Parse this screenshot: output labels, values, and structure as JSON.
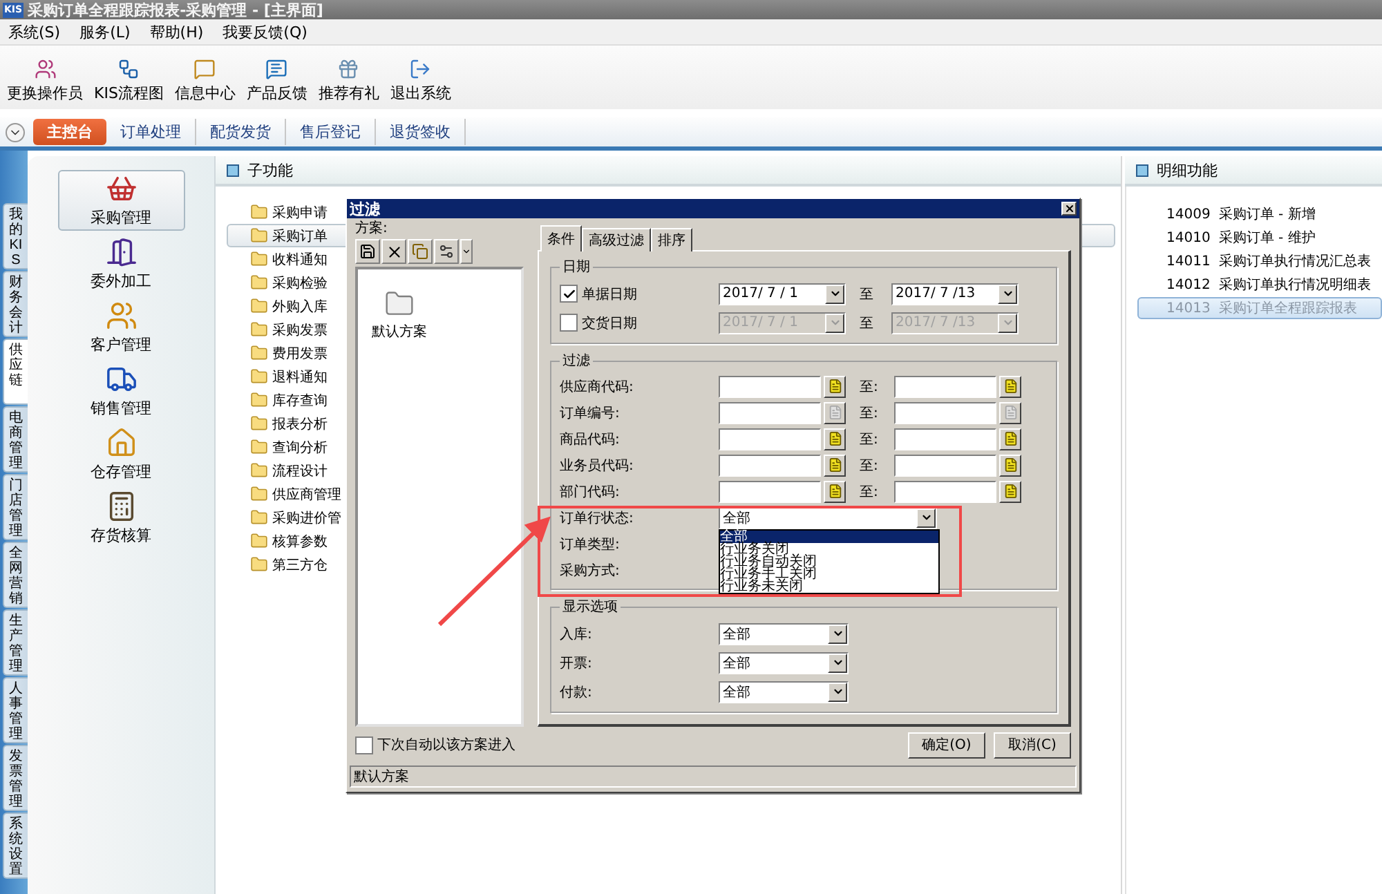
{
  "window": {
    "logo": "KIS",
    "title": "采购订单全程跟踪报表-采购管理 - [主界面]"
  },
  "menu": [
    "系统(S)",
    "服务(L)",
    "帮助(H)",
    "我要反馈(Q)"
  ],
  "toolbar": [
    {
      "kind": "operator",
      "label": "更换操作员"
    },
    {
      "kind": "flow",
      "label": "KIS流程图"
    },
    {
      "kind": "message",
      "label": "信息中心"
    },
    {
      "kind": "feedback",
      "label": "产品反馈"
    },
    {
      "kind": "gift",
      "label": "推荐有礼"
    },
    {
      "kind": "exit",
      "label": "退出系统"
    }
  ],
  "nav_tabs": [
    {
      "label": "主控台",
      "selected": true
    },
    {
      "label": "订单处理",
      "selected": false
    },
    {
      "label": "配货发货",
      "selected": false
    },
    {
      "label": "售后登记",
      "selected": false
    },
    {
      "label": "退货签收",
      "selected": false
    }
  ],
  "side_tabs": [
    {
      "label": "我的KIS",
      "selected": false
    },
    {
      "label": "财务会计",
      "selected": false
    },
    {
      "label": "供应链",
      "selected": true
    },
    {
      "label": "电商管理",
      "selected": false
    },
    {
      "label": "门店管理",
      "selected": false
    },
    {
      "label": "全网营销",
      "selected": false
    },
    {
      "label": "生产管理",
      "selected": false
    },
    {
      "label": "人事管理",
      "selected": false
    },
    {
      "label": "发票管理",
      "selected": false
    },
    {
      "label": "系统设置",
      "selected": false
    }
  ],
  "modules": [
    {
      "kind": "purchase",
      "label": "采购管理",
      "selected": true
    },
    {
      "kind": "outsource",
      "label": "委外加工",
      "selected": false
    },
    {
      "kind": "customer",
      "label": "客户管理",
      "selected": false
    },
    {
      "kind": "sales",
      "label": "销售管理",
      "selected": false
    },
    {
      "kind": "warehouse",
      "label": "仓存管理",
      "selected": false
    },
    {
      "kind": "inventory",
      "label": "存货核算",
      "selected": false
    }
  ],
  "sub_panel": {
    "title": "子功能",
    "items": [
      {
        "label": "采购申请",
        "selected": false
      },
      {
        "label": "采购订单",
        "selected": true
      },
      {
        "label": "收料通知",
        "selected": false
      },
      {
        "label": "采购检验",
        "selected": false
      },
      {
        "label": "外购入库",
        "selected": false
      },
      {
        "label": "采购发票",
        "selected": false
      },
      {
        "label": "费用发票",
        "selected": false
      },
      {
        "label": "退料通知",
        "selected": false
      },
      {
        "label": "库存查询",
        "selected": false
      },
      {
        "label": "报表分析",
        "selected": false
      },
      {
        "label": "查询分析",
        "selected": false
      },
      {
        "label": "流程设计",
        "selected": false
      },
      {
        "label": "供应商管理",
        "selected": false
      },
      {
        "label": "采购进价管",
        "selected": false
      },
      {
        "label": "核算参数",
        "selected": false
      },
      {
        "label": "第三方仓",
        "selected": false
      }
    ]
  },
  "detail_panel": {
    "title": "明细功能",
    "items": [
      {
        "code": "14009",
        "label": "采购订单 - 新增",
        "selected": false
      },
      {
        "code": "14010",
        "label": "采购订单 - 维护",
        "selected": false
      },
      {
        "code": "14011",
        "label": "采购订单执行情况汇总表",
        "selected": false
      },
      {
        "code": "14012",
        "label": "采购订单执行情况明细表",
        "selected": false
      },
      {
        "code": "14013",
        "label": "采购订单全程跟踪报表",
        "selected": true
      }
    ]
  },
  "dialog": {
    "title": "过滤",
    "scheme_label": "方案:",
    "schemes": [
      {
        "label": "默认方案"
      }
    ],
    "tabs": [
      {
        "label": "条件",
        "selected": true
      },
      {
        "label": "高级过滤",
        "selected": false
      },
      {
        "label": "排序",
        "selected": false
      }
    ],
    "date_group": {
      "title": "日期",
      "rows": [
        {
          "label": "单据日期",
          "checked": true,
          "from": "2017/ 7 / 1",
          "to_label": "至",
          "to": "2017/ 7 /13"
        },
        {
          "label": "交货日期",
          "checked": false,
          "from": "2017/ 7 / 1",
          "to_label": "至",
          "to": "2017/ 7 /13"
        }
      ]
    },
    "filter_group": {
      "title": "过滤",
      "rows": [
        {
          "kind": "range",
          "label": "供应商代码:",
          "to_label": "至:",
          "disabled": false
        },
        {
          "kind": "range",
          "label": "订单编号:",
          "to_label": "至:",
          "disabled": true
        },
        {
          "kind": "range",
          "label": "商品代码:",
          "to_label": "至:",
          "disabled": false
        },
        {
          "kind": "range",
          "label": "业务员代码:",
          "to_label": "至:",
          "disabled": false
        },
        {
          "kind": "range",
          "label": "部门代码:",
          "to_label": "至:",
          "disabled": false
        },
        {
          "kind": "select",
          "label": "订单行状态:",
          "value": "全部",
          "expanded": true,
          "options": [
            {
              "label": "全部",
              "selected": true
            },
            {
              "label": "行业务关闭",
              "selected": false
            },
            {
              "label": "行业务自动关闭",
              "selected": false
            },
            {
              "label": "行业务手工关闭",
              "selected": false
            },
            {
              "label": "行业务未关闭",
              "selected": false
            }
          ]
        },
        {
          "kind": "select",
          "label": "订单类型:"
        },
        {
          "kind": "select",
          "label": "采购方式:"
        }
      ]
    },
    "display_group": {
      "title": "显示选项",
      "rows": [
        {
          "label": "入库:",
          "value": "全部"
        },
        {
          "label": "开票:",
          "value": "全部"
        },
        {
          "label": "付款:",
          "value": "全部"
        }
      ]
    },
    "auto_enter": {
      "label": "下次自动以该方案进入",
      "checked": false
    },
    "buttons": [
      "确定(O)",
      "取消(C)"
    ],
    "status": "默认方案"
  }
}
